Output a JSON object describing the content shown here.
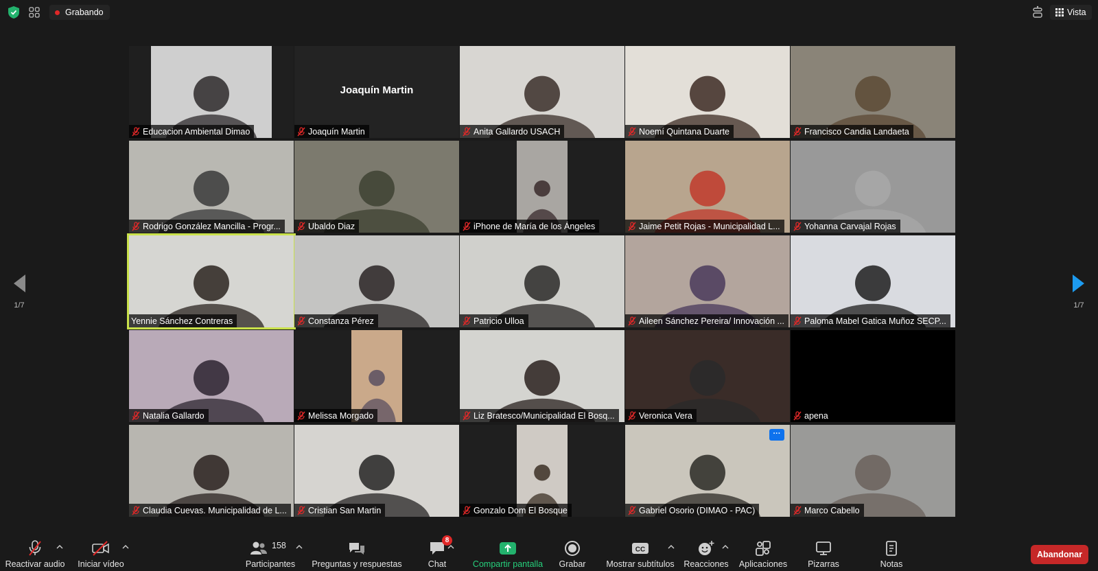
{
  "topbar": {
    "recording_label": "Grabando",
    "view_label": "Vista"
  },
  "pagination": {
    "left_label": "1/7",
    "right_label": "1/7"
  },
  "participants": [
    {
      "name": "Educacion Ambiental Dimao",
      "muted": true,
      "video": "portrait",
      "bg": "#cfcfcf",
      "fg": "#2e2a2c"
    },
    {
      "name": "Joaquín Martin",
      "muted": true,
      "video": "none",
      "display_name": "Joaquín Martin"
    },
    {
      "name": "Anita Gallardo USACH",
      "muted": true,
      "video": "full",
      "bg": "#d8d6d2",
      "fg": "#3b2f2a"
    },
    {
      "name": "Noemí Quintana Duarte",
      "muted": true,
      "video": "full",
      "bg": "#e3dfd8",
      "fg": "#3d2c24"
    },
    {
      "name": "Francisco Candia Landaeta",
      "muted": true,
      "video": "full",
      "bg": "#8a8478",
      "fg": "#5c4a35"
    },
    {
      "name": "Rodrigo González Mancilla - Progr...",
      "muted": true,
      "video": "full",
      "bg": "#b9b8b2",
      "fg": "#3a3a3a"
    },
    {
      "name": "Ubaldo Diaz",
      "muted": true,
      "video": "full",
      "bg": "#7c7a6e",
      "fg": "#3e4232"
    },
    {
      "name": "iPhone de María de los Ángeles",
      "muted": true,
      "video": "portrait",
      "bg": "#a9a6a2",
      "fg": "#3a2a2c"
    },
    {
      "name": "Jaime Petit Rojas - Municipalidad L...",
      "muted": true,
      "video": "full",
      "bg": "#b8a58e",
      "fg": "#c0392b"
    },
    {
      "name": "Yohanna Carvajal Rojas",
      "muted": true,
      "video": "full",
      "bg": "#999999",
      "fg": "#a8a8a8"
    },
    {
      "name": "Yennie Sánchez Contreras",
      "muted": false,
      "video": "full",
      "bg": "#d6d6d2",
      "fg": "#2b2420"
    },
    {
      "name": "Constanza Pérez",
      "muted": true,
      "video": "full",
      "bg": "#c4c4c2",
      "fg": "#2a2524"
    },
    {
      "name": "Patricio Ulloa",
      "muted": true,
      "video": "full",
      "bg": "#d0d0cc",
      "fg": "#2c2a28"
    },
    {
      "name": "Aileen Sánchez Pereira/ Innovación ...",
      "muted": true,
      "video": "full",
      "bg": "#b3a59d",
      "fg": "#4a3a5c"
    },
    {
      "name": "Paloma Mabel Gatica Muñoz SECP...",
      "muted": true,
      "video": "full",
      "bg": "#d9dbe0",
      "fg": "#1e1e1e"
    },
    {
      "name": "Natalia Gallardo",
      "muted": true,
      "video": "full",
      "bg": "#b9aab8",
      "fg": "#2d2530"
    },
    {
      "name": "Melissa Morgado",
      "muted": true,
      "video": "portrait",
      "bg": "#caa98a",
      "fg": "#5b5060"
    },
    {
      "name": "Liz Bratesco/Municipalidad El Bosq...",
      "muted": true,
      "video": "full",
      "bg": "#d4d4d0",
      "fg": "#2a211f"
    },
    {
      "name": "Veronica Vera",
      "muted": true,
      "video": "full",
      "bg": "#3a2c28",
      "fg": "#2a2a2a"
    },
    {
      "name": "apena",
      "muted": true,
      "video": "black"
    },
    {
      "name": "Claudia Cuevas. Municipalidad de L...",
      "muted": true,
      "video": "full",
      "bg": "#b8b6b0",
      "fg": "#2a2220"
    },
    {
      "name": "Cristian San Martin",
      "muted": true,
      "video": "full",
      "bg": "#d6d4d0",
      "fg": "#262424"
    },
    {
      "name": "Gonzalo Dom El Bosque",
      "muted": true,
      "video": "portrait",
      "bg": "#cfcac4",
      "fg": "#3c3026"
    },
    {
      "name": "Gabriel Osorio (DIMAO - PAC)",
      "muted": true,
      "video": "full",
      "bg": "#cac6bc",
      "fg": "#2c2a26",
      "more_menu": true
    },
    {
      "name": "Marco Cabello",
      "muted": true,
      "video": "full",
      "bg": "#9a9a98",
      "fg": "#6b625c"
    }
  ],
  "toolbar": {
    "unmute_label": "Reactivar audio",
    "start_video_label": "Iniciar vídeo",
    "participants_label": "Participantes",
    "participants_count": "158",
    "qa_label": "Preguntas y respuestas",
    "chat_label": "Chat",
    "chat_badge": "8",
    "share_label": "Compartir pantalla",
    "record_label": "Grabar",
    "captions_label": "Mostrar subtítulos",
    "reactions_label": "Reacciones",
    "apps_label": "Aplicaciones",
    "whiteboards_label": "Pizarras",
    "notes_label": "Notas",
    "leave_label": "Abandonar"
  },
  "colors": {
    "background": "#1a1a1a",
    "accent_green": "#26d07c",
    "leave_red": "#c62828",
    "speaker_outline": "#c9e14a",
    "muted_red": "#e02828"
  }
}
